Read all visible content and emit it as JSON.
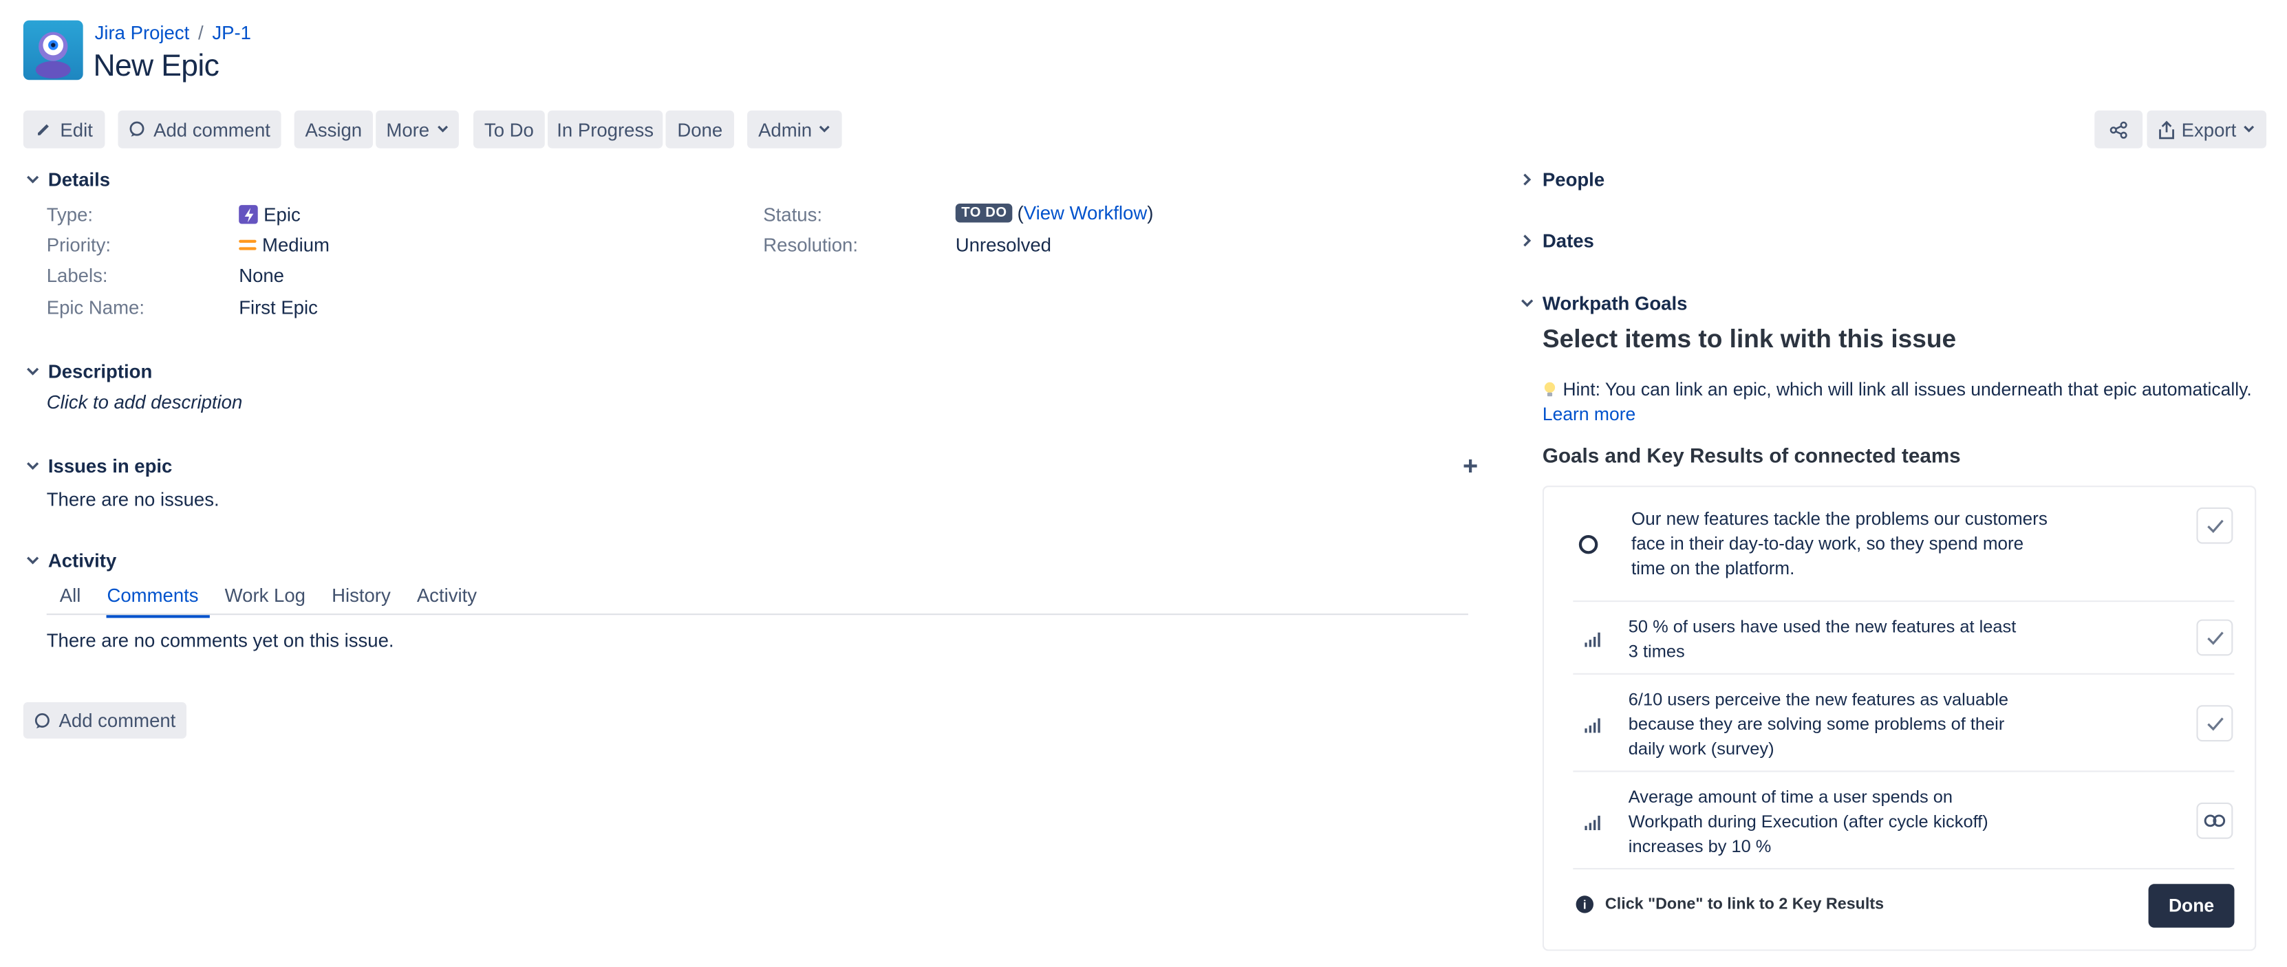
{
  "breadcrumb": {
    "project": "Jira Project",
    "separator": "/",
    "issue_key": "JP-1"
  },
  "issue": {
    "title": "New Epic"
  },
  "toolbar": {
    "edit": "Edit",
    "add_comment": "Add comment",
    "assign": "Assign",
    "more": "More",
    "todo": "To Do",
    "in_progress": "In Progress",
    "done": "Done",
    "admin": "Admin",
    "export": "Export"
  },
  "details": {
    "heading": "Details",
    "type_label": "Type:",
    "type_value": "Epic",
    "priority_label": "Priority:",
    "priority_value": "Medium",
    "labels_label": "Labels:",
    "labels_value": "None",
    "epic_name_label": "Epic Name:",
    "epic_name_value": "First Epic",
    "status_label": "Status:",
    "status_value": "TO DO",
    "view_workflow": "View Workflow",
    "resolution_label": "Resolution:",
    "resolution_value": "Unresolved"
  },
  "description": {
    "heading": "Description",
    "placeholder": "Click to add description"
  },
  "issues_in_epic": {
    "heading": "Issues in epic",
    "empty": "There are no issues."
  },
  "activity": {
    "heading": "Activity",
    "tabs": [
      "All",
      "Comments",
      "Work Log",
      "History",
      "Activity"
    ],
    "active_tab": "Comments",
    "empty": "There are no comments yet on this issue.",
    "add_comment": "Add comment"
  },
  "sidebar": {
    "people": "People",
    "dates": "Dates",
    "workpath": {
      "heading": "Workpath Goals",
      "title": "Select items to link with this issue",
      "hint": "Hint: You can link an epic, which will link all issues underneath that epic automatically.",
      "learn_more": "Learn more",
      "subheading": "Goals and Key Results of connected teams",
      "goal": {
        "line1": "Our new features tackle the problems our customers",
        "line2": "face in their day-to-day work, so they spend more",
        "line3": "time on the platform."
      },
      "key_results": [
        {
          "line1": "50 % of users have used the new features at least",
          "line2": "3 times",
          "line3": "",
          "state": "check"
        },
        {
          "line1": "6/10 users perceive the new features as valuable",
          "line2": "because they are solving some problems of their",
          "line3": "daily work (survey)",
          "state": "check"
        },
        {
          "line1": "Average amount of time a user spends on",
          "line2": "Workpath during Execution (after cycle kickoff)",
          "line3": "increases by 10 %",
          "state": "link"
        }
      ],
      "footer_info": "Click \"Done\" to link to 2 Key Results",
      "done": "Done"
    }
  },
  "colors": {
    "brand_blue": "#0052cc",
    "text": "#172b4d",
    "muted": "#6b778c",
    "button_bg": "#ebecf0",
    "lozenge": "#42526e",
    "epic_purple": "#6554c0",
    "priority_orange": "#ff991f",
    "done_button": "#253046"
  }
}
